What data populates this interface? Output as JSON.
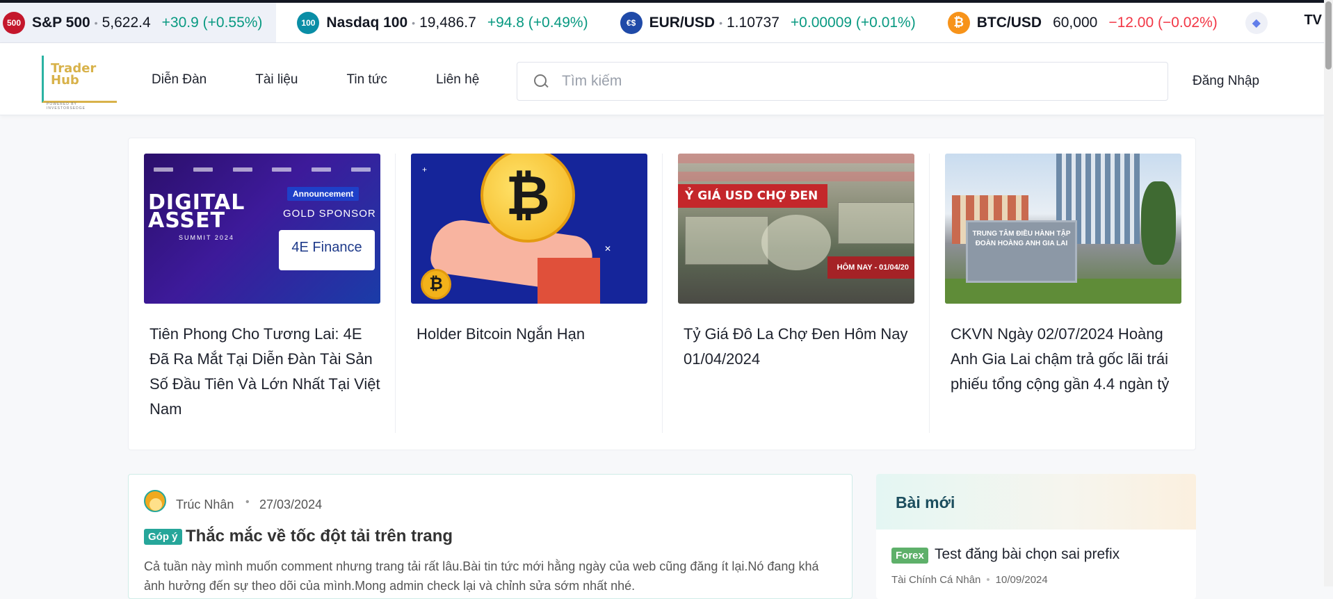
{
  "ticker": [
    {
      "logo_text": "500",
      "logo_color": "#c4172c",
      "symbol": "S&P 500",
      "price": "5,622.4",
      "change": "+30.9 (+0.55%)",
      "direction": "up"
    },
    {
      "logo_text": "100",
      "logo_color": "#0a8ea6",
      "symbol": "Nasdaq 100",
      "price": "19,486.7",
      "change": "+94.8 (+0.49%)",
      "direction": "up"
    },
    {
      "logo_text": "€$",
      "logo_color": "#1f4aa8",
      "symbol": "EUR/USD",
      "price": "1.10737",
      "change": "+0.00009 (+0.01%)",
      "direction": "up"
    },
    {
      "logo_text": "₿",
      "logo_color": "#f7931a",
      "symbol": "BTC/USD",
      "price": "60,000",
      "change": "−12.00 (−0.02%)",
      "direction": "down"
    }
  ],
  "header": {
    "brand_line1": "Trader",
    "brand_line2": "Hub",
    "brand_tagline": "POWERED BY INVESTORSEDGE",
    "nav": [
      "Diễn Đàn",
      "Tài liệu",
      "Tin tức",
      "Liên hệ"
    ],
    "search_placeholder": "Tìm kiếm",
    "login": "Đăng Nhập"
  },
  "featured": [
    {
      "title": "Tiên Phong Cho Tương Lai: 4E Đã Ra Mắt Tại Diễn Đàn Tài Sản Số Đầu Tiên Và Lớn Nhất Tại Việt Nam",
      "image_text": {
        "big1": "DIGITAL",
        "big2": "ASSET",
        "sub": "SUMMIT 2024",
        "announcement": "Announcement",
        "sponsor": "GOLD SPONSOR",
        "partner": "4E Finance"
      }
    },
    {
      "title": "Holder Bitcoin Ngắn Hạn",
      "image_text": {
        "coin": "₿",
        "small_coin": "₿"
      }
    },
    {
      "title": "Tỷ Giá Đô La Chợ Đen Hôm Nay 01/04/2024",
      "image_text": {
        "label": "Ỷ GIÁ USD CHỢ ĐEN",
        "date": "HÔM NAY - 01/04/20"
      }
    },
    {
      "title": "CKVN Ngày 02/07/2024 Hoàng Anh Gia Lai chậm trả gốc lãi trái phiếu tổng cộng gần 4.4 ngàn tỷ",
      "image_text": {
        "sign": "TRUNG TÂM ĐIỀU HÀNH TẬP ĐOÀN HOÀNG ANH GIA LAI"
      }
    }
  ],
  "post": {
    "author": "Trúc Nhân",
    "date": "27/03/2024",
    "tag": "Góp ý",
    "title": "Thắc mắc về tốc đột tải trên trang",
    "excerpt": "Cả tuần này mình muốn comment nhưng trang tải rất lâu.Bài tin tức mới hằng ngày của web cũng đăng ít lại.Nó đang khá ảnh hưởng đến sự theo dõi của mình.Mong admin check lại và chỉnh sửa sớm nhất nhé."
  },
  "sidebar": {
    "heading": "Bài mới",
    "items": [
      {
        "tag": "Forex",
        "title": "Test đăng bài chọn sai prefix",
        "category": "Tài Chính Cá Nhân",
        "date": "10/09/2024"
      }
    ]
  },
  "colors": {
    "up": "#089981",
    "down": "#f23645",
    "accent": "#26a69a",
    "brand_gold": "#d8b24a"
  }
}
